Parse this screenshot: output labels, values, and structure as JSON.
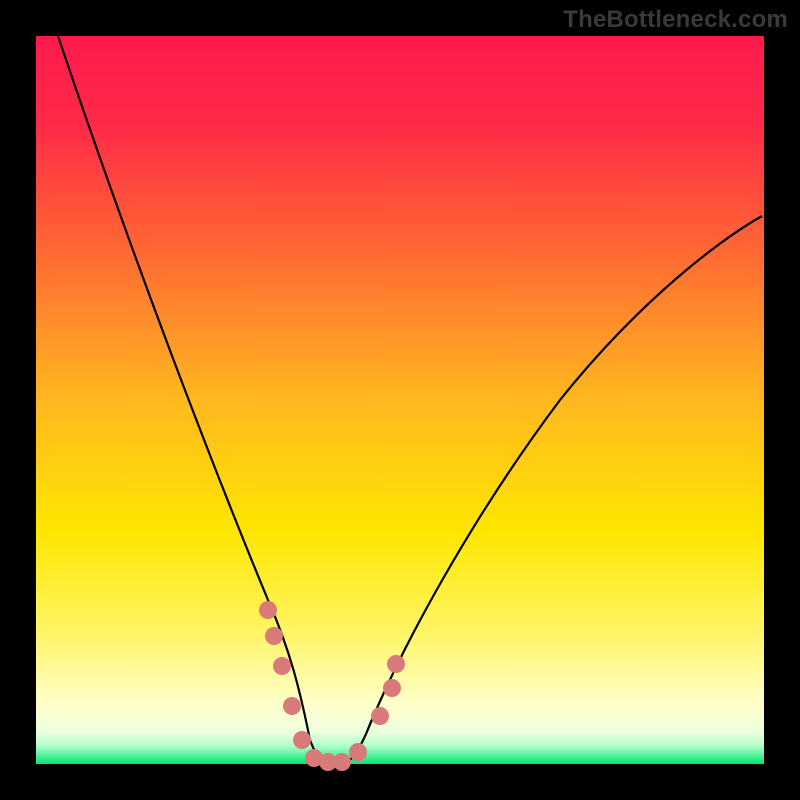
{
  "watermark": "TheBottleneck.com",
  "chart_data": {
    "type": "line",
    "title": "",
    "xlabel": "",
    "ylabel": "",
    "xlim": [
      0,
      100
    ],
    "ylim": [
      0,
      100
    ],
    "background": {
      "top_color": "#ff1a4d",
      "mid_color": "#ffe600",
      "bottom_color": "#00e673"
    },
    "series": [
      {
        "name": "curve",
        "x": [
          3,
          10,
          16,
          22,
          27,
          30,
          32,
          34,
          36,
          38,
          40,
          45,
          50,
          55,
          60,
          65,
          70,
          75,
          80,
          85,
          90,
          95,
          97
        ],
        "values": [
          100,
          80,
          63,
          48,
          34,
          24,
          16,
          8,
          2,
          0,
          0,
          2,
          10,
          20,
          30,
          40,
          48,
          55,
          60,
          64,
          67,
          69,
          70
        ]
      }
    ],
    "markers": {
      "name": "pink-markers",
      "color": "#d97a7a",
      "points": [
        {
          "x": 30,
          "y": 21
        },
        {
          "x": 31,
          "y": 17
        },
        {
          "x": 32,
          "y": 12
        },
        {
          "x": 33.5,
          "y": 6
        },
        {
          "x": 35,
          "y": 2
        },
        {
          "x": 37,
          "y": 0.5
        },
        {
          "x": 39,
          "y": 0.5
        },
        {
          "x": 41,
          "y": 0.5
        },
        {
          "x": 44,
          "y": 2
        },
        {
          "x": 47,
          "y": 7
        },
        {
          "x": 49,
          "y": 12
        },
        {
          "x": 49.5,
          "y": 15
        }
      ]
    }
  }
}
